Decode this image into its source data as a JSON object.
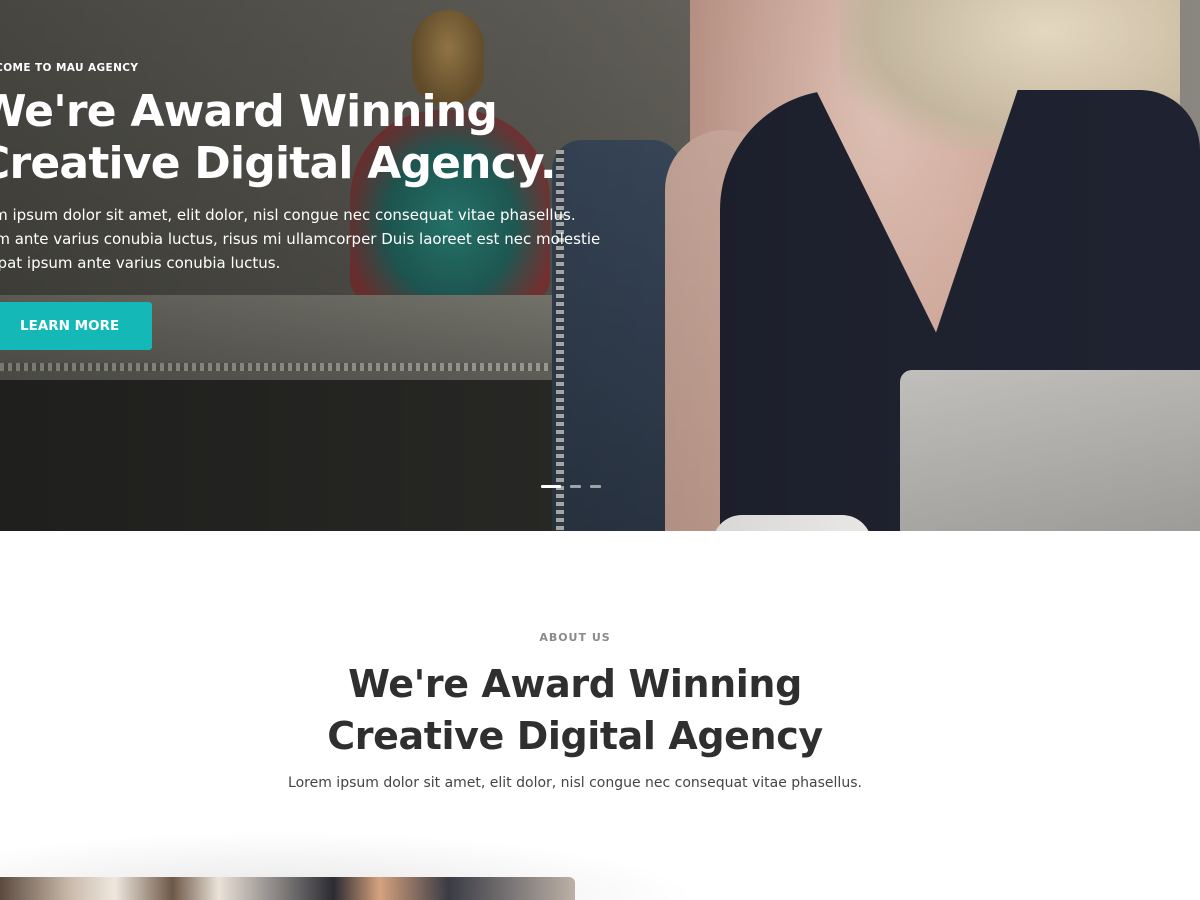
{
  "hero": {
    "kicker": "LCOME TO MAU AGENCY",
    "title_line1": "We're Award Winning",
    "title_line2": "Creative Digital Agency.",
    "text_line1": "rem ipsum dolor sit amet, elit dolor, nisl congue nec consequat vitae phasellus.",
    "text_line2": "sum ante varius conubia luctus, risus mi ullamcorper Duis laoreet est nec molestie",
    "text_line3": "lutpat ipsum ante varius conubia luctus.",
    "button_label": "LEARN MORE",
    "slider": {
      "slides": 3,
      "active_index": 0
    }
  },
  "about": {
    "kicker": "ABOUT US",
    "title_line1": "We're Award Winning",
    "title_line2": "Creative Digital Agency",
    "text": "Lorem ipsum dolor sit amet, elit dolor, nisl congue nec consequat vitae phasellus."
  },
  "colors": {
    "accent": "#14b8b6",
    "heading_dark": "#2f2f2f",
    "kicker_gray": "#8a8a8a"
  }
}
